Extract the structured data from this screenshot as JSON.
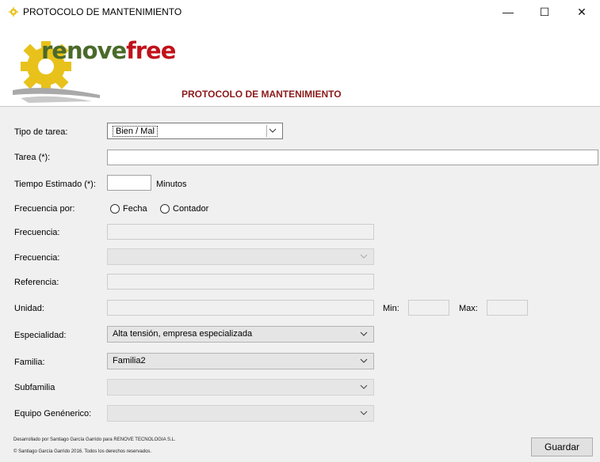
{
  "window": {
    "title": "PROTOCOLO DE MANTENIMIENTO",
    "minimize": "—",
    "maximize": "☐",
    "close": "✕"
  },
  "header": {
    "logo_text_a": "renove",
    "logo_text_b": "free",
    "title": "PROTOCOLO DE MANTENIMIENTO"
  },
  "form": {
    "tipo_tarea": {
      "label": "Tipo de tarea:",
      "value": "Bien / Mal"
    },
    "tarea": {
      "label": "Tarea (*):",
      "value": ""
    },
    "tiempo": {
      "label": "Tiempo Estimado (*):",
      "value": "",
      "unit": "Minutos"
    },
    "frecuencia_por": {
      "label": "Frecuencia por:",
      "option1": "Fecha",
      "option2": "Contador"
    },
    "frecuencia1": {
      "label": "Frecuencia:",
      "value": ""
    },
    "frecuencia2": {
      "label": "Frecuencia:",
      "value": ""
    },
    "referencia": {
      "label": "Referencia:",
      "value": ""
    },
    "unidad": {
      "label": "Unidad:",
      "value": "",
      "min_label": "Min:",
      "max_label": "Max:"
    },
    "especialidad": {
      "label": "Especialidad:",
      "value": "Alta tensión, empresa especializada"
    },
    "familia": {
      "label": "Familia:",
      "value": "Familia2"
    },
    "subfamilia": {
      "label": "Subfamilia",
      "value": ""
    },
    "equipo": {
      "label": "Equipo Genénerico:",
      "value": ""
    }
  },
  "footer": {
    "line1": "Desarrollado por Santiago García Garrido para RENOVE TECNOLOGIA S.L.",
    "line2": "© Santiago García Garrido 2016. Todos los derechos reservados.",
    "save_label": "Guardar"
  }
}
